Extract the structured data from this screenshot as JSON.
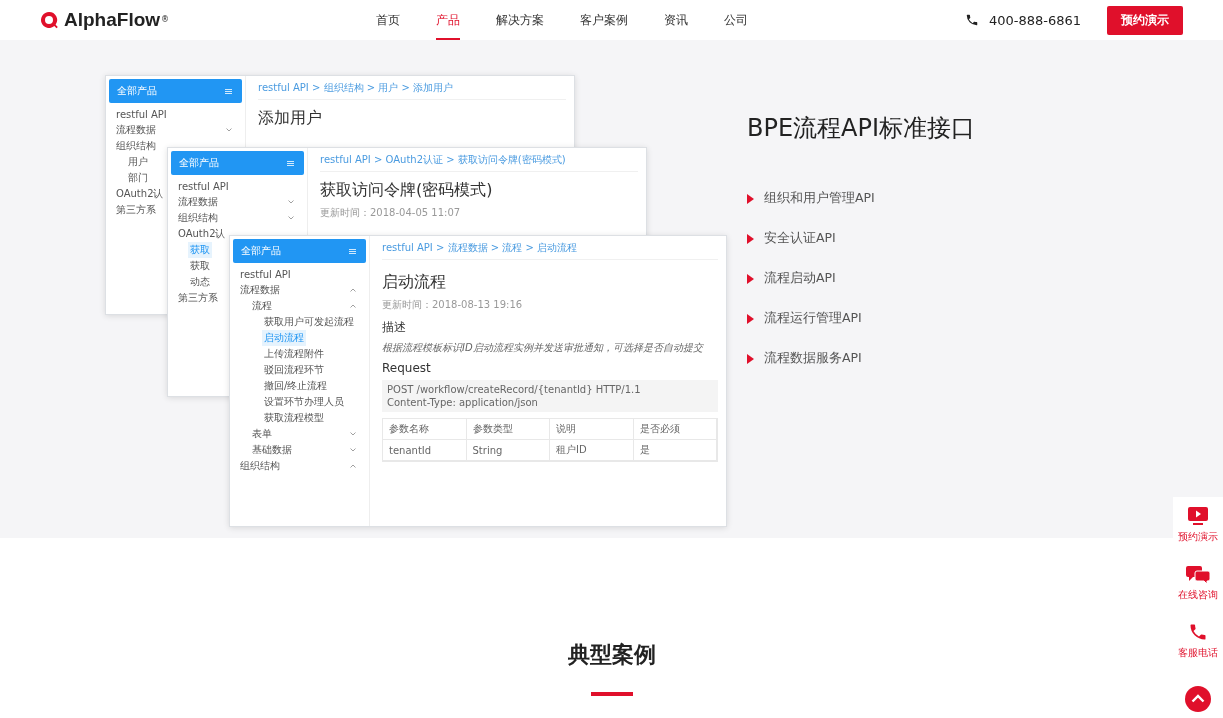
{
  "header": {
    "logo": {
      "name": "AlphaFlow",
      "mark": "®"
    },
    "nav": [
      {
        "label": "首页",
        "selected": false
      },
      {
        "label": "产品",
        "selected": true
      },
      {
        "label": "解决方案",
        "selected": false
      },
      {
        "label": "客户案例",
        "selected": false
      },
      {
        "label": "资讯",
        "selected": false
      },
      {
        "label": "公司",
        "selected": false
      }
    ],
    "phone": "400-888-6861",
    "cta": "预约演示"
  },
  "illustration": {
    "windows": [
      {
        "sidebar": {
          "title": "全部产品",
          "items": [
            {
              "label": "restful API"
            },
            {
              "label": "流程数据",
              "expanded": false
            },
            {
              "label": "组织结构",
              "children": [
                {
                  "label": "用户"
                },
                {
                  "label": "部门"
                }
              ]
            },
            {
              "label": "OAuth2认"
            },
            {
              "label": "第三方系"
            }
          ]
        },
        "content": {
          "breadcrumb": "restful API > 组织结构 > 用户 > 添加用户",
          "title": "添加用户"
        }
      },
      {
        "sidebar": {
          "title": "全部产品",
          "items": [
            {
              "label": "restful API"
            },
            {
              "label": "流程数据",
              "expanded": false
            },
            {
              "label": "组织结构",
              "expanded": false
            },
            {
              "label": "OAuth2认",
              "children": [
                {
                  "label": "获取",
                  "selected": true
                },
                {
                  "label": "获取",
                  "selected": false
                },
                {
                  "label": "动态",
                  "selected": false
                }
              ]
            },
            {
              "label": "第三方系"
            }
          ]
        },
        "content": {
          "breadcrumb": "restful API > OAuth2认证 > 获取访问令牌(密码模式)",
          "title": "获取访问令牌(密码模式)",
          "updated": "更新时间：2018-04-05 11:07"
        }
      },
      {
        "sidebar": {
          "title": "全部产品",
          "items": [
            {
              "label": "restful API"
            },
            {
              "label": "流程数据",
              "expanded": true,
              "children": [
                {
                  "label": "流程",
                  "expanded": true,
                  "children": [
                    {
                      "label": "获取用户可发起流程",
                      "selected": false
                    },
                    {
                      "label": "启动流程",
                      "selected": true
                    },
                    {
                      "label": "上传流程附件",
                      "selected": false
                    },
                    {
                      "label": "驳回流程环节",
                      "selected": false
                    },
                    {
                      "label": "撤回/终止流程",
                      "selected": false
                    },
                    {
                      "label": "设置环节办理人员",
                      "selected": false
                    },
                    {
                      "label": "获取流程模型",
                      "selected": false
                    }
                  ]
                },
                {
                  "label": "表单",
                  "expanded": false
                },
                {
                  "label": "基础数据",
                  "expanded": false
                }
              ]
            },
            {
              "label": "组织结构",
              "expanded": true
            }
          ]
        },
        "content": {
          "breadcrumb": "restful API > 流程数据 > 流程 > 启动流程",
          "title": "启动流程",
          "updated": "更新时间：2018-08-13 19:16",
          "section": "描述",
          "description": "根据流程模板标识ID启动流程实例并发送审批通知，可选择是否自动提交",
          "request_title": "Request",
          "code": [
            "POST /workflow/createRecord/{tenantId} HTTP/1.1",
            "Content-Type: application/json"
          ],
          "table": {
            "columns": [
              "参数名称",
              "参数类型",
              "说明",
              "是否必须"
            ],
            "rows": [
              [
                "tenantId",
                "String",
                "租户ID",
                "是"
              ]
            ]
          }
        }
      }
    ]
  },
  "feature": {
    "title": "BPE流程API标准接口",
    "points": [
      "组织和用户管理API",
      "安全认证API",
      "流程启动API",
      "流程运行管理API",
      "流程数据服务API"
    ]
  },
  "cases": {
    "title": "典型案例"
  },
  "float_bar": [
    {
      "kind": "demo",
      "label": "预约演示"
    },
    {
      "kind": "chat",
      "label": "在线咨询"
    },
    {
      "kind": "phone",
      "label": "客服电话"
    },
    {
      "kind": "top"
    }
  ]
}
